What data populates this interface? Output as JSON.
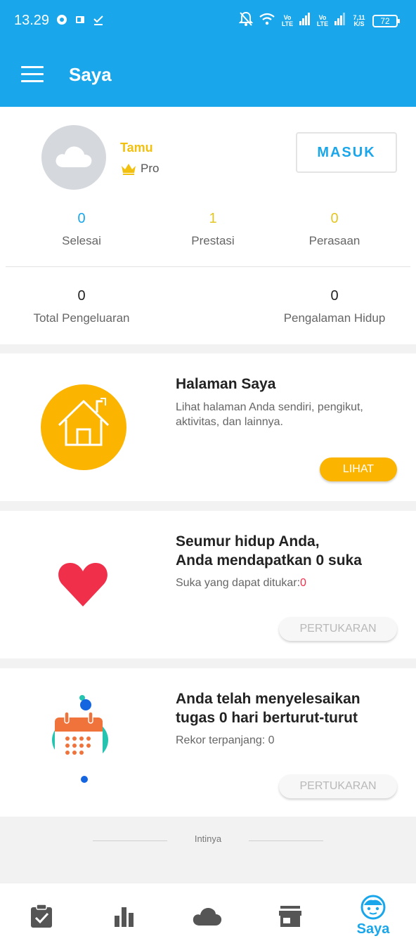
{
  "status_bar": {
    "time": "13.29",
    "lte1": "Vo LTE",
    "lte2": "Vo LTE",
    "speed": "7,11 K/S",
    "battery": "72"
  },
  "app_bar": {
    "title": "Saya"
  },
  "profile": {
    "name": "Tamu",
    "badge": "Pro",
    "login_button": "MASUK",
    "stats": [
      {
        "value": "0",
        "label": "Selesai",
        "color": "#1aa6ea"
      },
      {
        "value": "1",
        "label": "Prestasi",
        "color": "#e2c624"
      },
      {
        "value": "0",
        "label": "Perasaan",
        "color": "#e2c624"
      }
    ],
    "stats2": [
      {
        "value": "0",
        "label": "Total Pengeluaran"
      },
      {
        "value": "0",
        "label": "Pengalaman Hidup"
      }
    ]
  },
  "my_page": {
    "title": "Halaman Saya",
    "description": "Lihat halaman Anda sendiri, pengikut, aktivitas, dan lainnya.",
    "button": "LIHAT"
  },
  "likes": {
    "title_line1": "Seumur hidup Anda,",
    "title_line2": "Anda mendapatkan 0 suka",
    "redeemable_label": "Suka yang dapat ditukar:",
    "redeemable_value": "0",
    "button": "PERTUKARAN"
  },
  "streak": {
    "title_line1": "Anda telah menyelesaikan",
    "title_line2": "tugas 0 hari berturut-turut",
    "record": "Rekor terpanjang: 0",
    "button": "PERTUKARAN"
  },
  "footer": {
    "label": "Intinya"
  },
  "bottom_nav": {
    "items": [
      {
        "icon": "clipboard-check-icon"
      },
      {
        "icon": "bar-chart-icon"
      },
      {
        "icon": "cloud-icon"
      },
      {
        "icon": "store-icon"
      },
      {
        "icon": "face-icon",
        "label": "Saya",
        "active": true
      }
    ],
    "active_color": "#1aa6ea",
    "inactive_color": "#555555"
  },
  "colors": {
    "primary": "#1aa6ea",
    "accent_yellow": "#fbb400",
    "heart": "#f0304b"
  }
}
